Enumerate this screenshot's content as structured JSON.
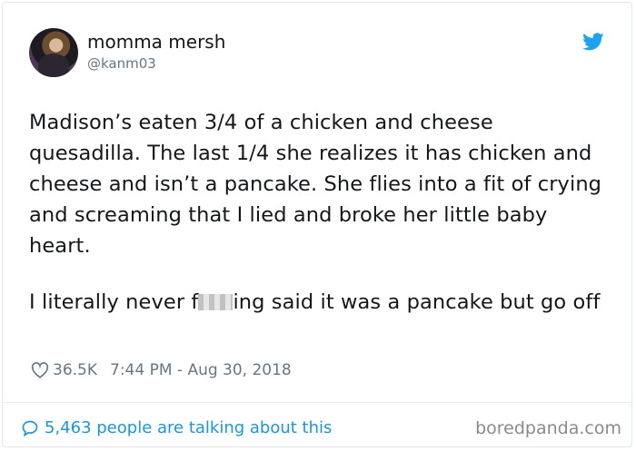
{
  "author": {
    "name": "momma mersh",
    "handle": "@kanm03"
  },
  "tweet": {
    "paragraph1": "Madison’s eaten 3/4 of a chicken and cheese quesadilla. The last 1/4 she realizes it has chicken and cheese and isn’t a pancake. She flies into a fit of crying and screaming that I lied and broke her little baby heart.",
    "paragraph2_before": "I literally never f",
    "paragraph2_after": "ing said it was a pancake but go off"
  },
  "meta": {
    "likes": "36.5K",
    "timestamp": "7:44 PM - Aug 30, 2018"
  },
  "footer": {
    "talking": "5,463 people are talking about this",
    "watermark": "boredpanda.com"
  },
  "colors": {
    "link_blue": "#1b95e0",
    "twitter_blue": "#1da1f2",
    "muted": "#657786"
  }
}
